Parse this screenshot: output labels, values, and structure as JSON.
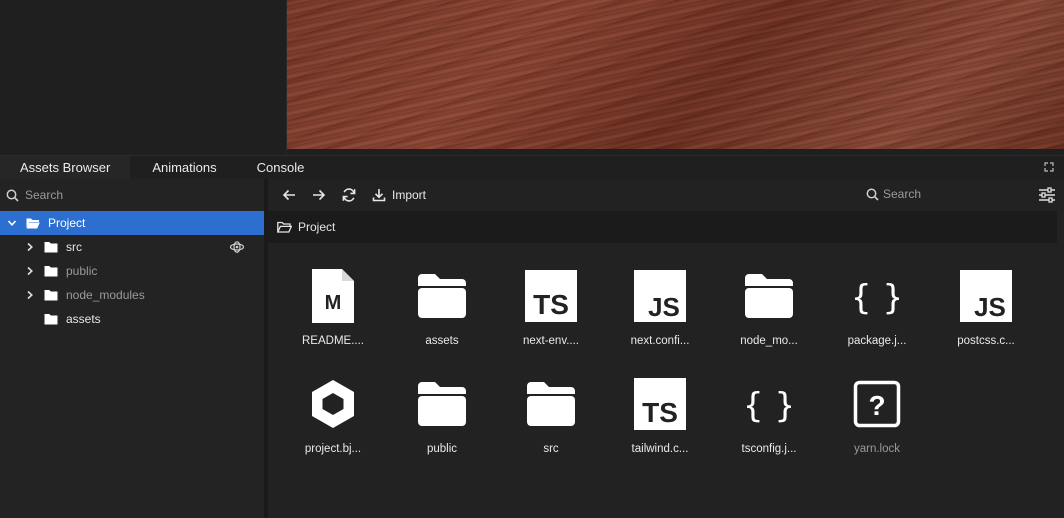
{
  "tabs": [
    {
      "label": "Assets Browser",
      "active": true
    },
    {
      "label": "Animations",
      "active": false
    },
    {
      "label": "Console",
      "active": false
    }
  ],
  "left": {
    "search_placeholder": "Search",
    "tree": [
      {
        "label": "Project",
        "expanded": true,
        "selected": true
      },
      {
        "label": "src",
        "expanded": false
      },
      {
        "label": "public",
        "expanded": false
      },
      {
        "label": "node_modules",
        "expanded": false
      },
      {
        "label": "assets"
      }
    ]
  },
  "toolbar": {
    "import_label": "Import",
    "search_placeholder": "Search"
  },
  "breadcrumb": {
    "label": "Project"
  },
  "assets": [
    {
      "name": "README....",
      "icon": "markdown-file-icon"
    },
    {
      "name": "assets",
      "icon": "folder-icon"
    },
    {
      "name": "next-env....",
      "icon": "typescript-file-icon"
    },
    {
      "name": "next.confi...",
      "icon": "javascript-file-icon"
    },
    {
      "name": "node_mo...",
      "icon": "folder-icon"
    },
    {
      "name": "package.j...",
      "icon": "json-file-icon"
    },
    {
      "name": "postcss.c...",
      "icon": "javascript-file-icon"
    },
    {
      "name": "project.bj...",
      "icon": "project-file-icon"
    },
    {
      "name": "public",
      "icon": "folder-icon"
    },
    {
      "name": "src",
      "icon": "folder-icon"
    },
    {
      "name": "tailwind.c...",
      "icon": "typescript-file-icon"
    },
    {
      "name": "tsconfig.j...",
      "icon": "json-file-icon"
    },
    {
      "name": "yarn.lock",
      "icon": "unknown-file-icon"
    }
  ],
  "colors": {
    "accent": "#2d6fd1",
    "background": "#222222"
  }
}
